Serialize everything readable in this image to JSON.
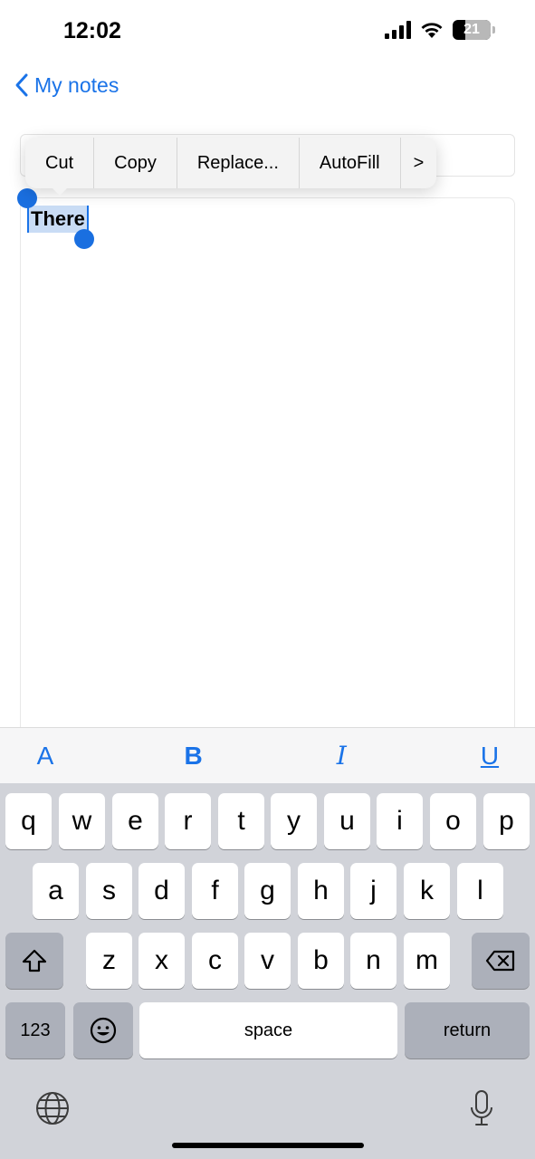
{
  "status_bar": {
    "time": "12:02",
    "battery": "21"
  },
  "nav": {
    "back_label": "My notes"
  },
  "note": {
    "selected_text": "There"
  },
  "context_menu": {
    "items": [
      "Cut",
      "Copy",
      "Replace...",
      "AutoFill"
    ],
    "more": ">"
  },
  "format_toolbar": {
    "font": "A",
    "bold": "B",
    "italic": "I",
    "underline": "U"
  },
  "keyboard": {
    "row1": [
      "q",
      "w",
      "e",
      "r",
      "t",
      "y",
      "u",
      "i",
      "o",
      "p"
    ],
    "row2": [
      "a",
      "s",
      "d",
      "f",
      "g",
      "h",
      "j",
      "k",
      "l"
    ],
    "row3": [
      "z",
      "x",
      "c",
      "v",
      "b",
      "n",
      "m"
    ],
    "numbers": "123",
    "space": "space",
    "return": "return"
  },
  "colors": {
    "accent": "#1a73e8",
    "keyboard_bg": "#d1d3d9",
    "selection": "#c9dcf5"
  }
}
